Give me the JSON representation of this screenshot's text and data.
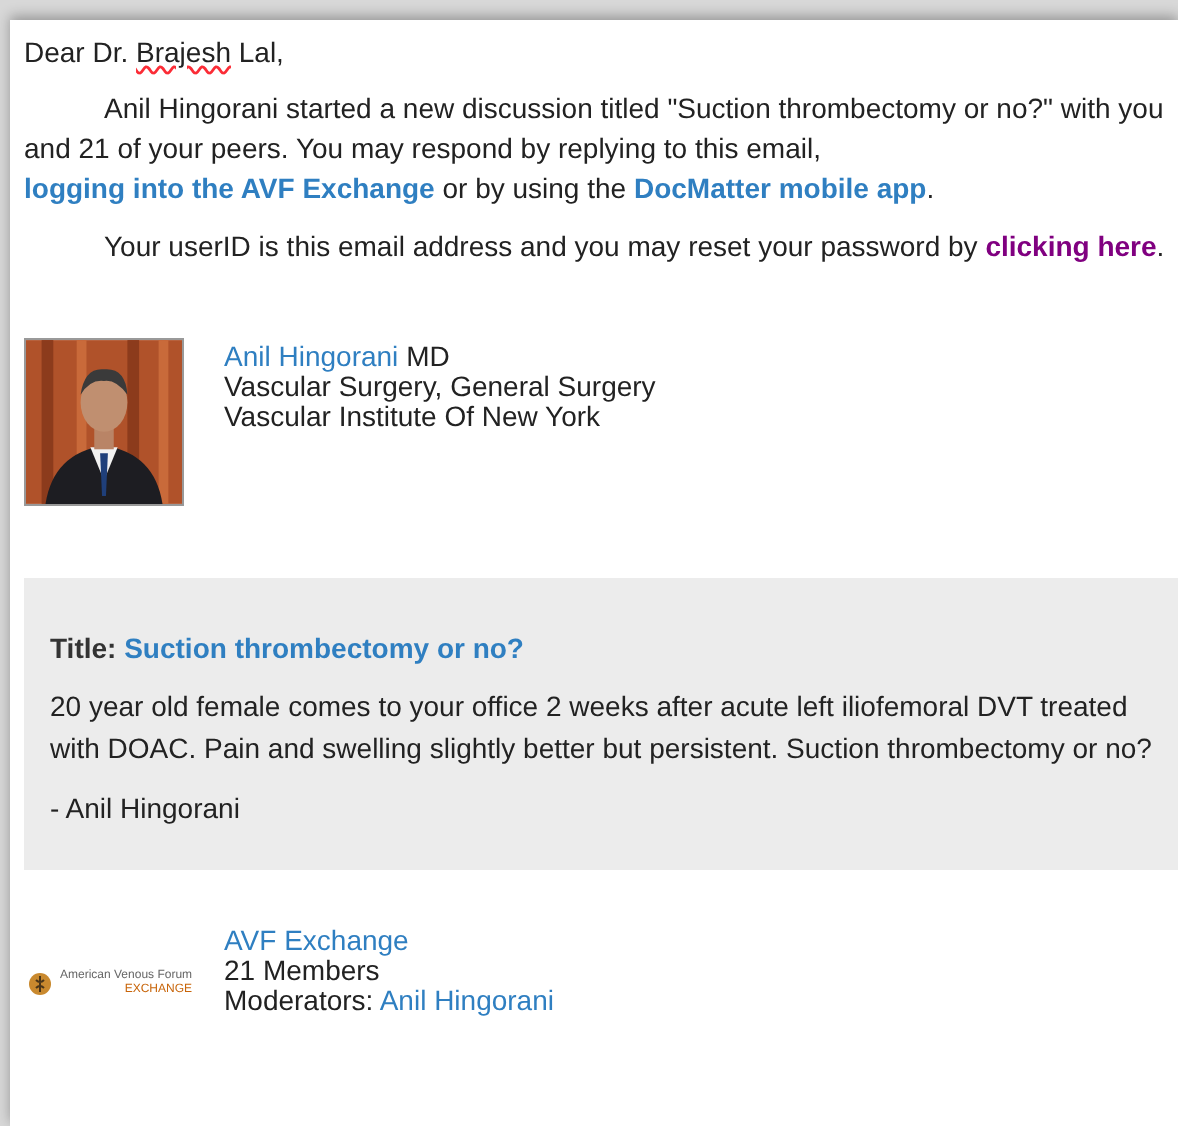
{
  "greeting": {
    "prefix": "Dear Dr. ",
    "name": "Brajesh",
    "suffix": " Lal,"
  },
  "intro": {
    "parts": [
      {
        "kind": "text",
        "text": "Anil Hingorani started a new discussion titled \"Suction thrombectomy or no?\" with you and 21 of your peers. You may respond by replying to this email, "
      },
      {
        "kind": "link",
        "text": "logging into the AVF Exchange",
        "color": "#2f7fc1"
      },
      {
        "kind": "text",
        "text": " or by using the "
      },
      {
        "kind": "link",
        "text": "DocMatter mobile app",
        "color": "#2f7fc1"
      },
      {
        "kind": "text",
        "text": "."
      }
    ]
  },
  "reset": {
    "parts": [
      {
        "kind": "text",
        "text": "Your userID is this email address and you may reset your password by "
      },
      {
        "kind": "link",
        "text": "clicking here",
        "color": "#800080"
      },
      {
        "kind": "text",
        "text": "."
      }
    ]
  },
  "author": {
    "name": "Anil Hingorani",
    "degree": "MD",
    "specialty": "Vascular Surgery, General Surgery",
    "institution": "Vascular Institute Of New York"
  },
  "post": {
    "title_label": "Title:",
    "title": "Suction thrombectomy or no?",
    "body": "20 year old female comes to your office 2 weeks after acute left iliofemoral DVT treated with DOAC. Pain and swelling slightly better but persistent. Suction thrombectomy or no?",
    "signature": "- Anil Hingorani"
  },
  "community": {
    "logo_name": "American Venous Forum",
    "logo_sub": "EXCHANGE",
    "name": "AVF Exchange",
    "members": "21 Members",
    "moderators_label": "Moderators:",
    "moderator": "Anil Hingorani"
  }
}
